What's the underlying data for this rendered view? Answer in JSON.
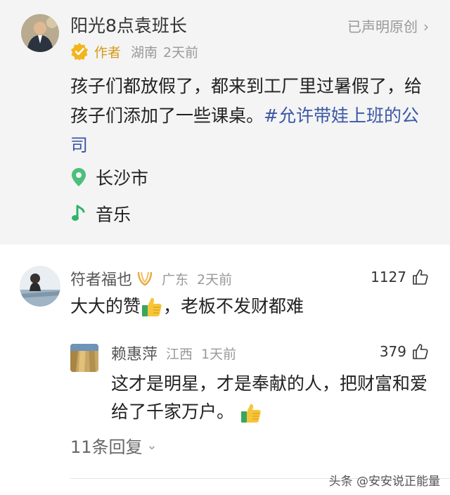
{
  "post": {
    "author_name": "阳光8点袁班长",
    "original_label": "已声明原创",
    "original_chevron": "›",
    "role": "作者",
    "location": "湖南",
    "time": "2天前",
    "text_main": "孩子们都放假了，都来到工厂里过暑假了，给孩子们添加了一些课桌。",
    "hashtag": "#允许带娃上班的公司",
    "place": "长沙市",
    "music": "音乐"
  },
  "comment": {
    "name": "符者福也",
    "location": "广东",
    "time": "2天前",
    "likes": "1127",
    "text_before": "大大的赞",
    "text_after": "，老板不发财都难",
    "reply": {
      "name": "赖惠萍",
      "location": "江西",
      "time": "1天前",
      "likes": "379",
      "text": "这才是明星，才是奉献的人，把财富和爱给了千家万户。"
    },
    "more_replies": "11条回复",
    "more_chevron": "⌄"
  },
  "watermark": "头条 @安安说正能量",
  "icons": {
    "verified": "verified-badge-icon",
    "location": "location-pin-icon",
    "music": "music-note-icon",
    "like": "thumbs-up-outline-icon",
    "thumbs_emoji": "thumbs-up-emoji-icon",
    "medal": "medal-icon"
  },
  "colors": {
    "hashtag": "#3b57a6",
    "role": "#d49a1a",
    "location_pin": "#4cbf7a",
    "music_note": "#2fb36b"
  }
}
